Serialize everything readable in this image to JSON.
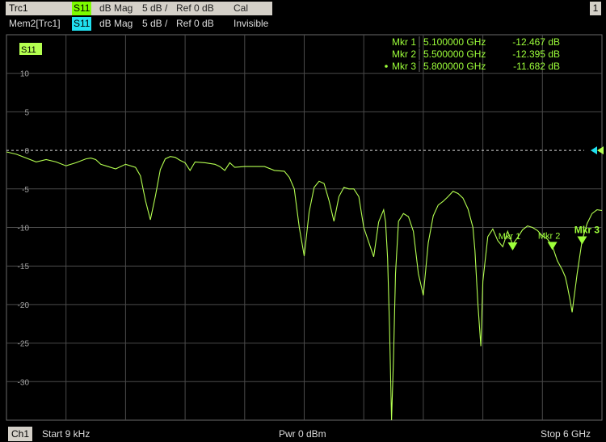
{
  "header": {
    "trace1": {
      "name": "Trc1",
      "param": "S11",
      "format": "dB Mag",
      "scale": "5 dB /",
      "ref": "Ref 0 dB",
      "status": "Cal"
    },
    "trace2": {
      "name": "Mem2[Trc1]",
      "param": "S11",
      "format": "dB Mag",
      "scale": "5 dB /",
      "ref": "Ref 0 dB",
      "status": "Invisible"
    },
    "window_number": "1"
  },
  "footer": {
    "channel": "Ch1",
    "start": "Start  9 kHz",
    "power": "Pwr  0 dBm",
    "stop": "Stop  6 GHz"
  },
  "colors": {
    "trace": "#b4ff50",
    "memory": "#20e0f0",
    "grid": "#4a4a4a",
    "marker": "#9dff3a",
    "background": "#000000"
  },
  "chart_data": {
    "type": "line",
    "trace_label": "S11",
    "xlim": [
      9e-06,
      6.0
    ],
    "ylim": [
      -35,
      15
    ],
    "ref_level": 0,
    "y_ticks": [
      10,
      5,
      0,
      -5,
      -10,
      -15,
      -20,
      -25,
      -30
    ],
    "y_tick_labels": [
      "10",
      "5",
      "0",
      "-5",
      "-10",
      "-15",
      "-20",
      "-25",
      "-30"
    ],
    "grid": true,
    "series": [
      {
        "x": [
          0.0,
          0.1,
          0.2,
          0.3,
          0.4,
          0.5,
          0.6,
          0.7,
          0.8,
          0.85,
          0.9,
          0.95,
          1.0,
          1.1,
          1.2,
          1.3,
          1.35,
          1.4,
          1.45,
          1.5,
          1.55,
          1.6,
          1.65,
          1.7,
          1.75,
          1.8,
          1.85,
          1.9,
          2.0,
          2.1,
          2.15,
          2.2,
          2.25,
          2.3,
          2.4,
          2.5,
          2.6,
          2.7,
          2.8,
          2.85,
          2.9,
          2.95,
          3.0,
          3.05,
          3.1,
          3.15,
          3.2,
          3.25,
          3.3,
          3.35,
          3.4,
          3.45,
          3.5,
          3.55,
          3.6,
          3.7,
          3.75,
          3.8,
          3.82,
          3.84,
          3.86,
          3.88,
          3.9,
          3.92,
          3.95,
          4.0,
          4.05,
          4.1,
          4.15,
          4.2,
          4.25,
          4.3,
          4.35,
          4.4,
          4.45,
          4.5,
          4.55,
          4.6,
          4.65,
          4.7,
          4.72,
          4.75,
          4.78,
          4.8,
          4.85,
          4.9,
          4.95,
          5.0,
          5.05,
          5.1,
          5.15,
          5.2,
          5.25,
          5.3,
          5.35,
          5.4,
          5.45,
          5.5,
          5.55,
          5.6,
          5.63,
          5.65,
          5.68,
          5.7,
          5.75,
          5.8,
          5.85,
          5.9,
          5.95,
          6.0
        ],
        "y": [
          -0.2,
          -0.5,
          -1.0,
          -1.5,
          -1.2,
          -1.5,
          -2.0,
          -1.6,
          -1.1,
          -1.0,
          -1.2,
          -1.8,
          -2.0,
          -2.4,
          -1.8,
          -2.2,
          -3.3,
          -6.5,
          -9.0,
          -6.0,
          -2.5,
          -1.1,
          -0.8,
          -0.9,
          -1.3,
          -1.6,
          -2.6,
          -1.5,
          -1.6,
          -1.8,
          -2.1,
          -2.6,
          -1.6,
          -2.2,
          -2.1,
          -2.1,
          -2.1,
          -2.6,
          -2.7,
          -3.5,
          -5.0,
          -10.0,
          -13.7,
          -8.0,
          -4.8,
          -4.0,
          -4.3,
          -6.5,
          -9.2,
          -6.0,
          -4.8,
          -5.0,
          -5.0,
          -6.0,
          -10.0,
          -13.8,
          -9.3,
          -7.7,
          -9.3,
          -14.0,
          -23.0,
          -35.0,
          -27.0,
          -16.0,
          -9.2,
          -8.2,
          -8.6,
          -10.5,
          -16.0,
          -18.8,
          -12.0,
          -8.5,
          -7.1,
          -6.6,
          -6.0,
          -5.3,
          -5.6,
          -6.2,
          -7.6,
          -10.0,
          -13.0,
          -20.0,
          -25.4,
          -17.0,
          -11.2,
          -10.2,
          -11.7,
          -12.5,
          -10.5,
          -12.2,
          -11.3,
          -10.3,
          -9.8,
          -10.0,
          -10.4,
          -11.1,
          -11.5,
          -12.4,
          -14.3,
          -15.5,
          -16.4,
          -17.5,
          -19.5,
          -21.0,
          -16.0,
          -11.7,
          -9.5,
          -8.2,
          -7.7,
          -7.8
        ]
      }
    ],
    "markers": [
      {
        "label": "Mkr 1",
        "x": 5.1,
        "y": -12.467,
        "freq_text": "5.100000 GHz",
        "val_text": "-12.467 dB",
        "active": false
      },
      {
        "label": "Mkr 2",
        "x": 5.5,
        "y": -12.395,
        "freq_text": "5.500000 GHz",
        "val_text": "-12.395 dB",
        "active": false
      },
      {
        "label": "Mkr 3",
        "x": 5.8,
        "y": -11.682,
        "freq_text": "5.800000 GHz",
        "val_text": "-11.682 dB",
        "active": true
      }
    ]
  }
}
